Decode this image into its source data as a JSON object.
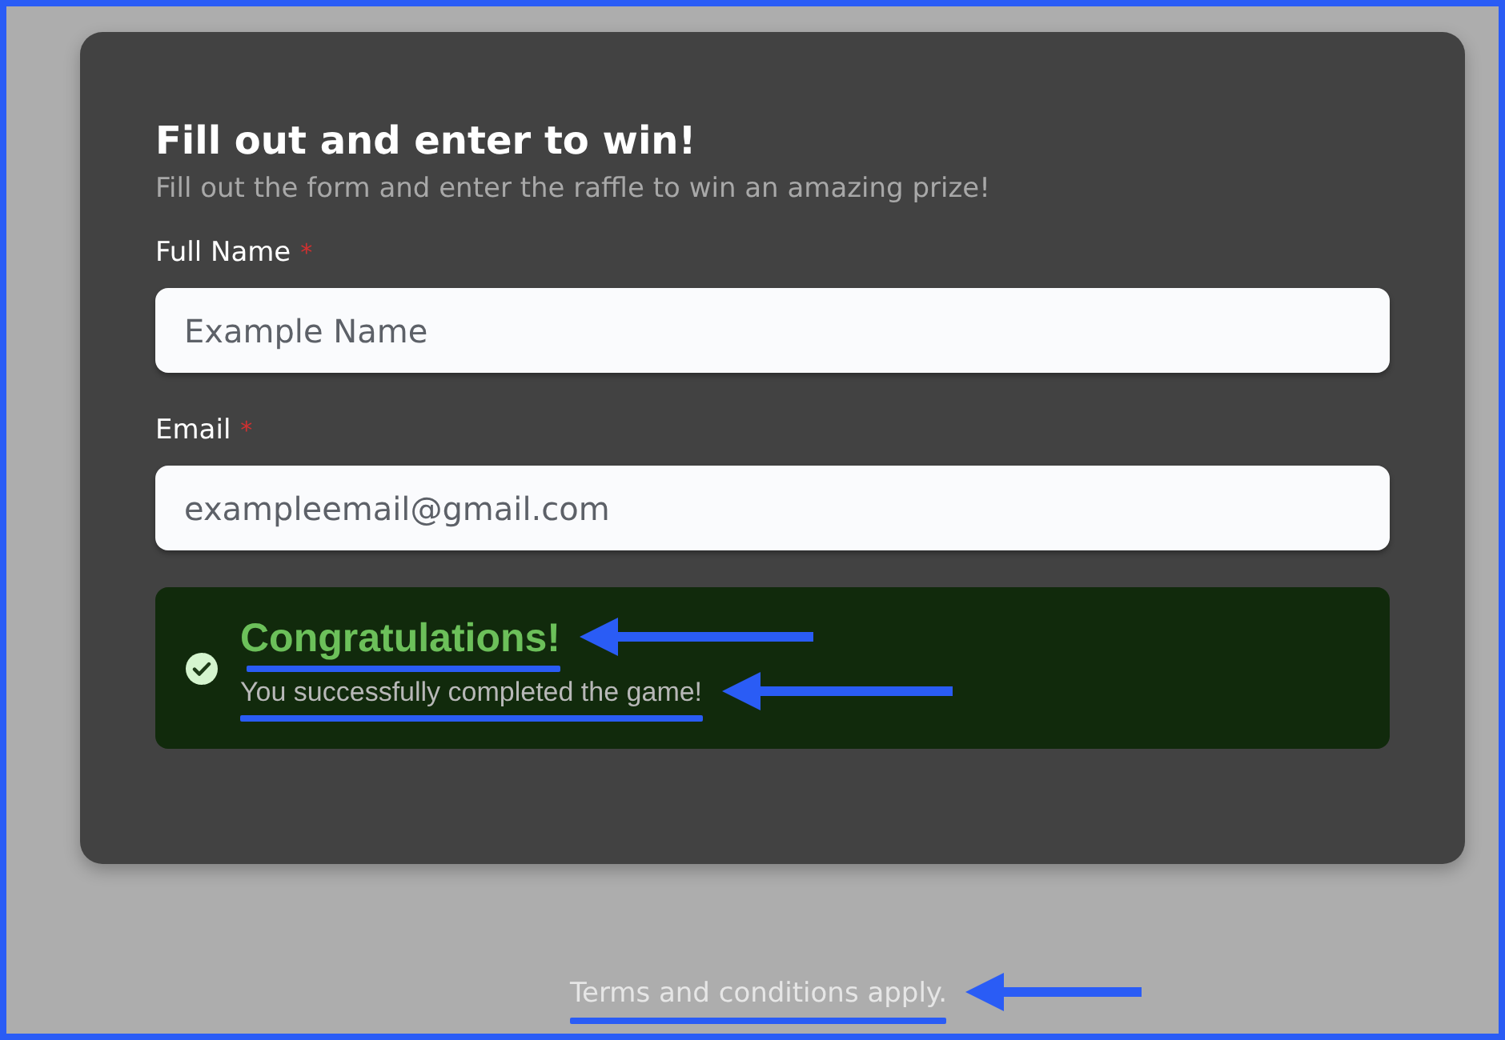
{
  "form": {
    "title": "Fill out and enter to win!",
    "subtitle": "Fill out the form and enter the raffle to win an amazing prize!",
    "fields": [
      {
        "label": "Full Name",
        "required_mark": "*",
        "placeholder": "Example Name"
      },
      {
        "label": "Email",
        "required_mark": "*",
        "placeholder": "exampleemail@gmail.com"
      }
    ],
    "alert": {
      "kind": "success",
      "title": "Congratulations!",
      "message": "You successfully completed the game!"
    }
  },
  "footer": {
    "text": "Terms and conditions apply."
  }
}
